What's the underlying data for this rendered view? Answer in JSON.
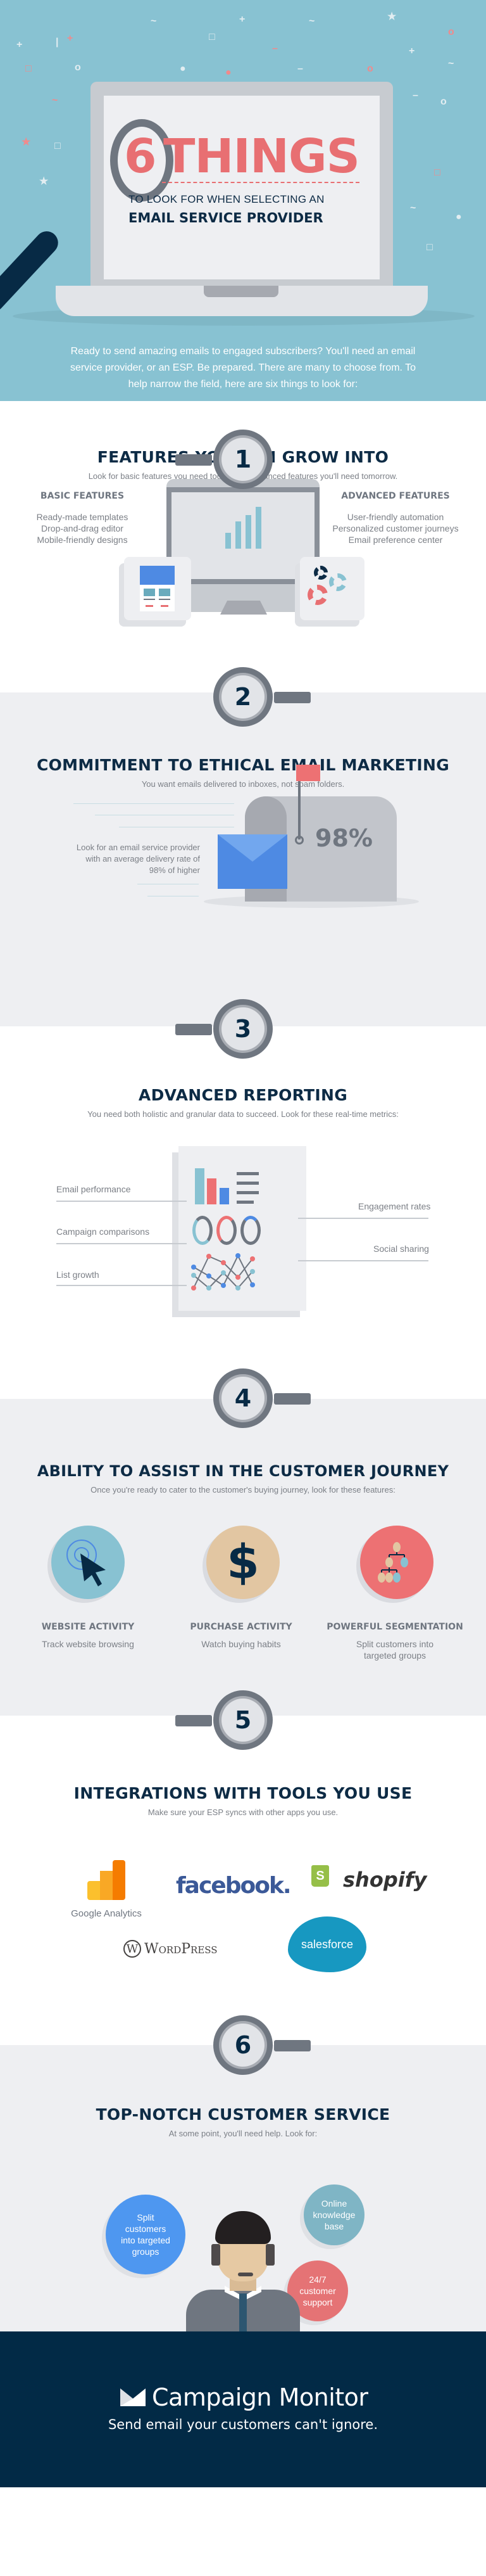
{
  "hero": {
    "number": "6",
    "title_word": "THINGS",
    "subtitle_line1": "TO LOOK FOR WHEN SELECTING AN",
    "subtitle_line2": "EMAIL SERVICE PROVIDER",
    "intro": "Ready to send amazing emails to engaged subscribers? You'll need an email service provider, or an ESP. Be prepared. There are many to choose from. To help narrow the field, here are six things to look for:",
    "colors": {
      "background": "#88c2d2",
      "accent": "#e86f72",
      "navy": "#0d2b45"
    }
  },
  "steps": [
    {
      "number": "1",
      "title": "FEATURES YOU CAN GROW INTO",
      "subtitle": "Look for basic features you need today, and advanced features you'll need tomorrow.",
      "basic": {
        "heading": "BASIC FEATURES",
        "items": [
          "Ready-made templates",
          "Drop-and-drag editor",
          "Mobile-friendly designs"
        ]
      },
      "advanced": {
        "heading": "ADVANCED FEATURES",
        "items": [
          "User-friendly automation",
          "Personalized customer journeys",
          "Email preference center"
        ]
      }
    },
    {
      "number": "2",
      "title": "COMMITMENT TO ETHICAL EMAIL MARKETING",
      "subtitle": "You want emails delivered to inboxes, not spam folders.",
      "note": "Look for an email service provider with an average delivery rate of 98% of higher",
      "stat": "98%"
    },
    {
      "number": "3",
      "title": "ADVANCED REPORTING",
      "subtitle": "You need both holistic and granular data to succeed. Look for these real-time metrics:",
      "left_metrics": [
        "Email performance",
        "Campaign comparisons",
        "List growth"
      ],
      "right_metrics": [
        "Engagement rates",
        "Social sharing"
      ]
    },
    {
      "number": "4",
      "title": "ABILITY TO ASSIST IN THE CUSTOMER JOURNEY",
      "subtitle": "Once you're ready to cater to the customer's buying journey, look for these features:",
      "features": [
        {
          "icon": "cursor-click-icon",
          "title": "WEBSITE ACTIVITY",
          "desc": "Track website browsing",
          "color": "#88c2d2"
        },
        {
          "icon": "dollar-sign-icon",
          "title": "PURCHASE ACTIVITY",
          "desc": "Watch buying habits",
          "color": "#e2c6a2"
        },
        {
          "icon": "org-chart-icon",
          "title": "POWERFUL SEGMENTATION",
          "desc": "Split customers into targeted groups",
          "color": "#ed7173"
        }
      ]
    },
    {
      "number": "5",
      "title": "INTEGRATIONS WITH TOOLS YOU USE",
      "subtitle": "Make sure your ESP syncs with other apps you use.",
      "logos": {
        "google_analytics": "Google Analytics",
        "facebook": "facebook.",
        "shopify": "shopify",
        "wordpress": "WordPress",
        "salesforce": "salesforce"
      }
    },
    {
      "number": "6",
      "title": "TOP-NOTCH CUSTOMER SERVICE",
      "subtitle": "At some point, you'll need help. Look for:",
      "bubbles": [
        {
          "text": "Split customers into targeted groups",
          "color": "#4e97f0"
        },
        {
          "text": "Online knowledge base",
          "color": "#7fb5c5"
        },
        {
          "text": "24/7 customer support",
          "color": "#e57375"
        }
      ]
    }
  ],
  "footer": {
    "brand": "Campaign Monitor",
    "tagline": "Send email your customers can't ignore."
  }
}
